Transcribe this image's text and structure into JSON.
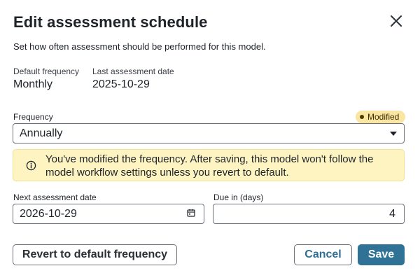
{
  "dialog": {
    "title": "Edit assessment schedule",
    "subtitle": "Set how often assessment should be performed for this model."
  },
  "defaults": {
    "default_frequency_label": "Default frequency",
    "default_frequency_value": "Monthly",
    "last_assessment_label": "Last assessment date",
    "last_assessment_value": "2025-10-29"
  },
  "frequency": {
    "label": "Frequency",
    "badge": "Modified",
    "selected": "Annually"
  },
  "warning": {
    "text": "You've modified the frequency. After saving, this model won't follow the model workflow settings unless you revert to default."
  },
  "next_assessment": {
    "label": "Next assessment date",
    "value": "2026-10-29"
  },
  "due_in": {
    "label": "Due in (days)",
    "value": "4"
  },
  "buttons": {
    "revert": "Revert to default frequency",
    "cancel": "Cancel",
    "save": "Save"
  },
  "colors": {
    "primary": "#2f7296",
    "warning_bg": "#fdf4c2",
    "badge_bg": "#fbe5a3"
  },
  "icons": {
    "close": "close-icon",
    "info": "info-icon",
    "calendar": "calendar-icon",
    "dropdown": "chevron-down-icon"
  }
}
